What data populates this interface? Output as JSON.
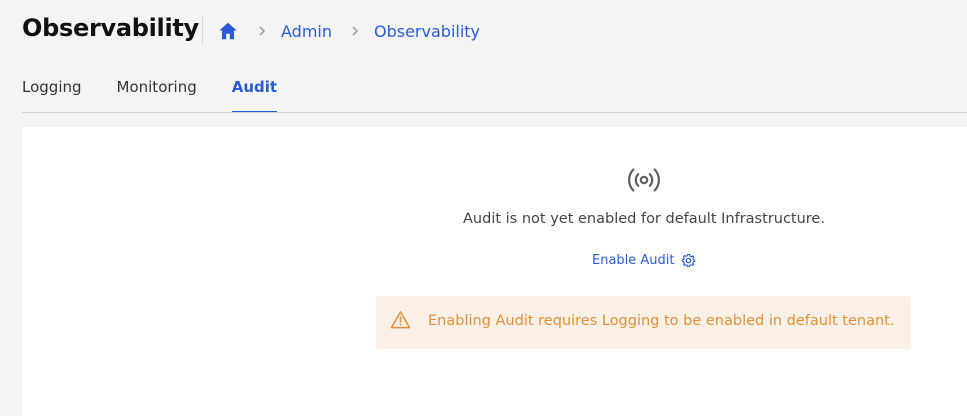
{
  "header": {
    "title": "Observability",
    "breadcrumb": {
      "home_icon": "home-icon",
      "items": [
        "Admin",
        "Observability"
      ]
    }
  },
  "tabs": [
    {
      "label": "Logging",
      "active": false
    },
    {
      "label": "Monitoring",
      "active": false
    },
    {
      "label": "Audit",
      "active": true
    }
  ],
  "audit": {
    "icon": "broadcast-signal-icon",
    "message": "Audit is not yet enabled for default Infrastructure.",
    "enable_label": "Enable Audit",
    "enable_icon": "gear-icon",
    "warning": {
      "icon": "warning-triangle-icon",
      "text": "Enabling Audit requires Logging to be enabled in default tenant."
    }
  },
  "colors": {
    "accent": "#2a5bd7",
    "warning_text": "#e0913a",
    "warning_bg": "#fbf0e6",
    "page_bg": "#f4f4f5"
  }
}
